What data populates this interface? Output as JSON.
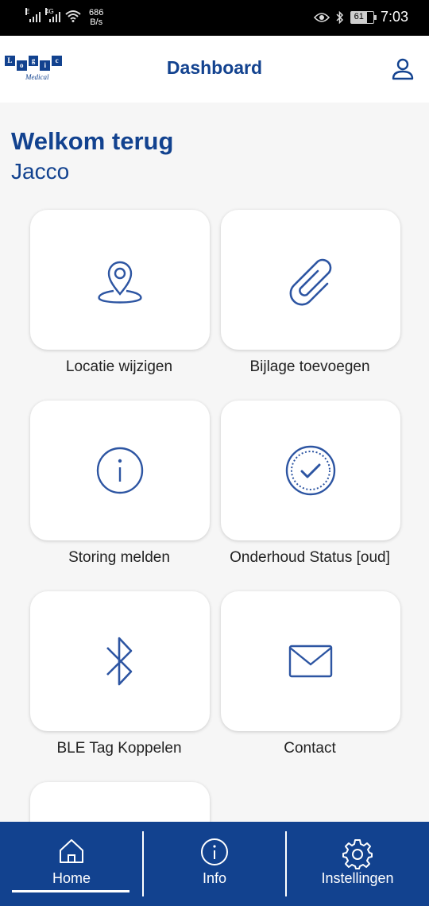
{
  "status_bar": {
    "signal1_label": "E",
    "signal2_label": "4G",
    "net_speed_value": "686",
    "net_speed_unit": "B/s",
    "battery": "61",
    "time": "7:03"
  },
  "header": {
    "logo_text": "Medical",
    "title": "Dashboard"
  },
  "welcome": {
    "heading": "Welkom terug",
    "name": "Jacco"
  },
  "tiles": [
    {
      "label": "Locatie wijzigen",
      "icon": "location-pin-icon"
    },
    {
      "label": "Bijlage toevoegen",
      "icon": "paperclip-icon"
    },
    {
      "label": "Storing melden",
      "icon": "info-circle-icon"
    },
    {
      "label": "Onderhoud Status [oud]",
      "icon": "check-badge-icon"
    },
    {
      "label": "BLE Tag Koppelen",
      "icon": "bluetooth-icon"
    },
    {
      "label": "Contact",
      "icon": "envelope-icon"
    }
  ],
  "nav": {
    "items": [
      {
        "label": "Home",
        "icon": "home-icon",
        "active": true
      },
      {
        "label": "Info",
        "icon": "info-icon"
      },
      {
        "label": "Instellingen",
        "icon": "gear-icon"
      }
    ]
  },
  "colors": {
    "brand": "#12428f",
    "background": "#f6f6f6"
  }
}
